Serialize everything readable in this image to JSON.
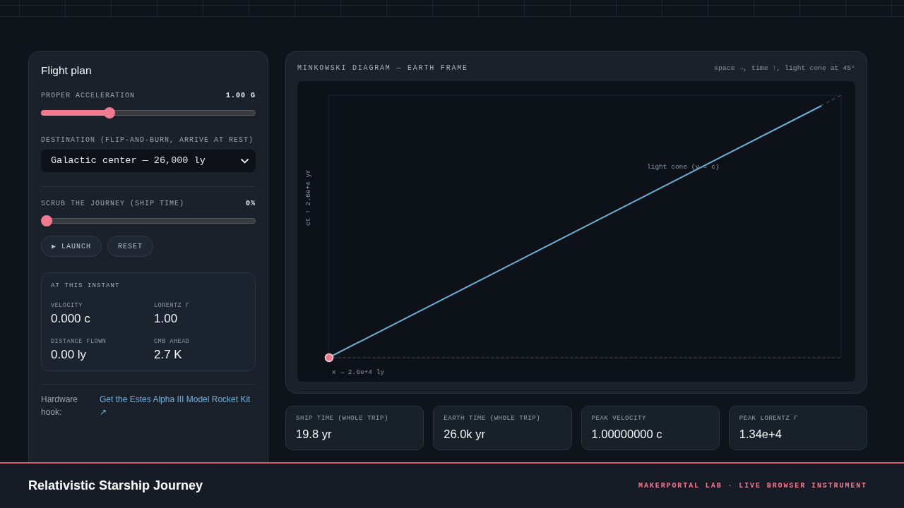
{
  "controls": {
    "title": "Flight plan",
    "acceleration": {
      "label": "PROPER ACCELERATION",
      "reading": "1.00 G",
      "level": 0.31
    },
    "destination": {
      "label": "DESTINATION (FLIP-AND-BURN, ARRIVE AT REST)",
      "value": "Galactic center — 26,000 ly"
    },
    "scrub": {
      "label": "SCRUB THE JOURNEY (SHIP TIME)",
      "reading": "0%",
      "level": 0
    },
    "buttons": [
      {
        "label": "▶ LAUNCH"
      },
      {
        "label": "RESET"
      }
    ],
    "instant": {
      "title": "AT THIS INSTANT",
      "readouts": [
        {
          "label": "VELOCITY",
          "value": "0.000 c"
        },
        {
          "label": "LORENTZ Γ",
          "value": "1.00"
        },
        {
          "label": "DISTANCE FLOWN",
          "value": "0.00 ly"
        },
        {
          "label": "CMB AHEAD",
          "value": "2.7 K"
        }
      ]
    },
    "hardware": {
      "label": "Hardware hook:",
      "link": "Get the Estes Alpha III Model Rocket Kit ↗"
    }
  },
  "diagram": {
    "title": "MINKOWSKI DIAGRAM — EARTH FRAME",
    "hint": "space →, time ↑, light cone at 45°",
    "y_axis_label": "ct ↑ 2.6e+4 yr",
    "x_axis_label": "x → 2.6e+4 ly",
    "light_cone_label": "light cone (v = c)"
  },
  "stats": [
    {
      "label": "SHIP TIME (WHOLE TRIP)",
      "value": "19.8 yr"
    },
    {
      "label": "EARTH TIME (WHOLE TRIP)",
      "value": "26.0k yr"
    },
    {
      "label": "PEAK VELOCITY",
      "value": "1.00000000 c"
    },
    {
      "label": "PEAK LORENTZ Γ",
      "value": "1.34e+4"
    }
  ],
  "footer": {
    "title": "Relativistic Starship Journey",
    "credit": "MAKERPORTAL LAB · LIVE BROWSER INSTRUMENT"
  }
}
